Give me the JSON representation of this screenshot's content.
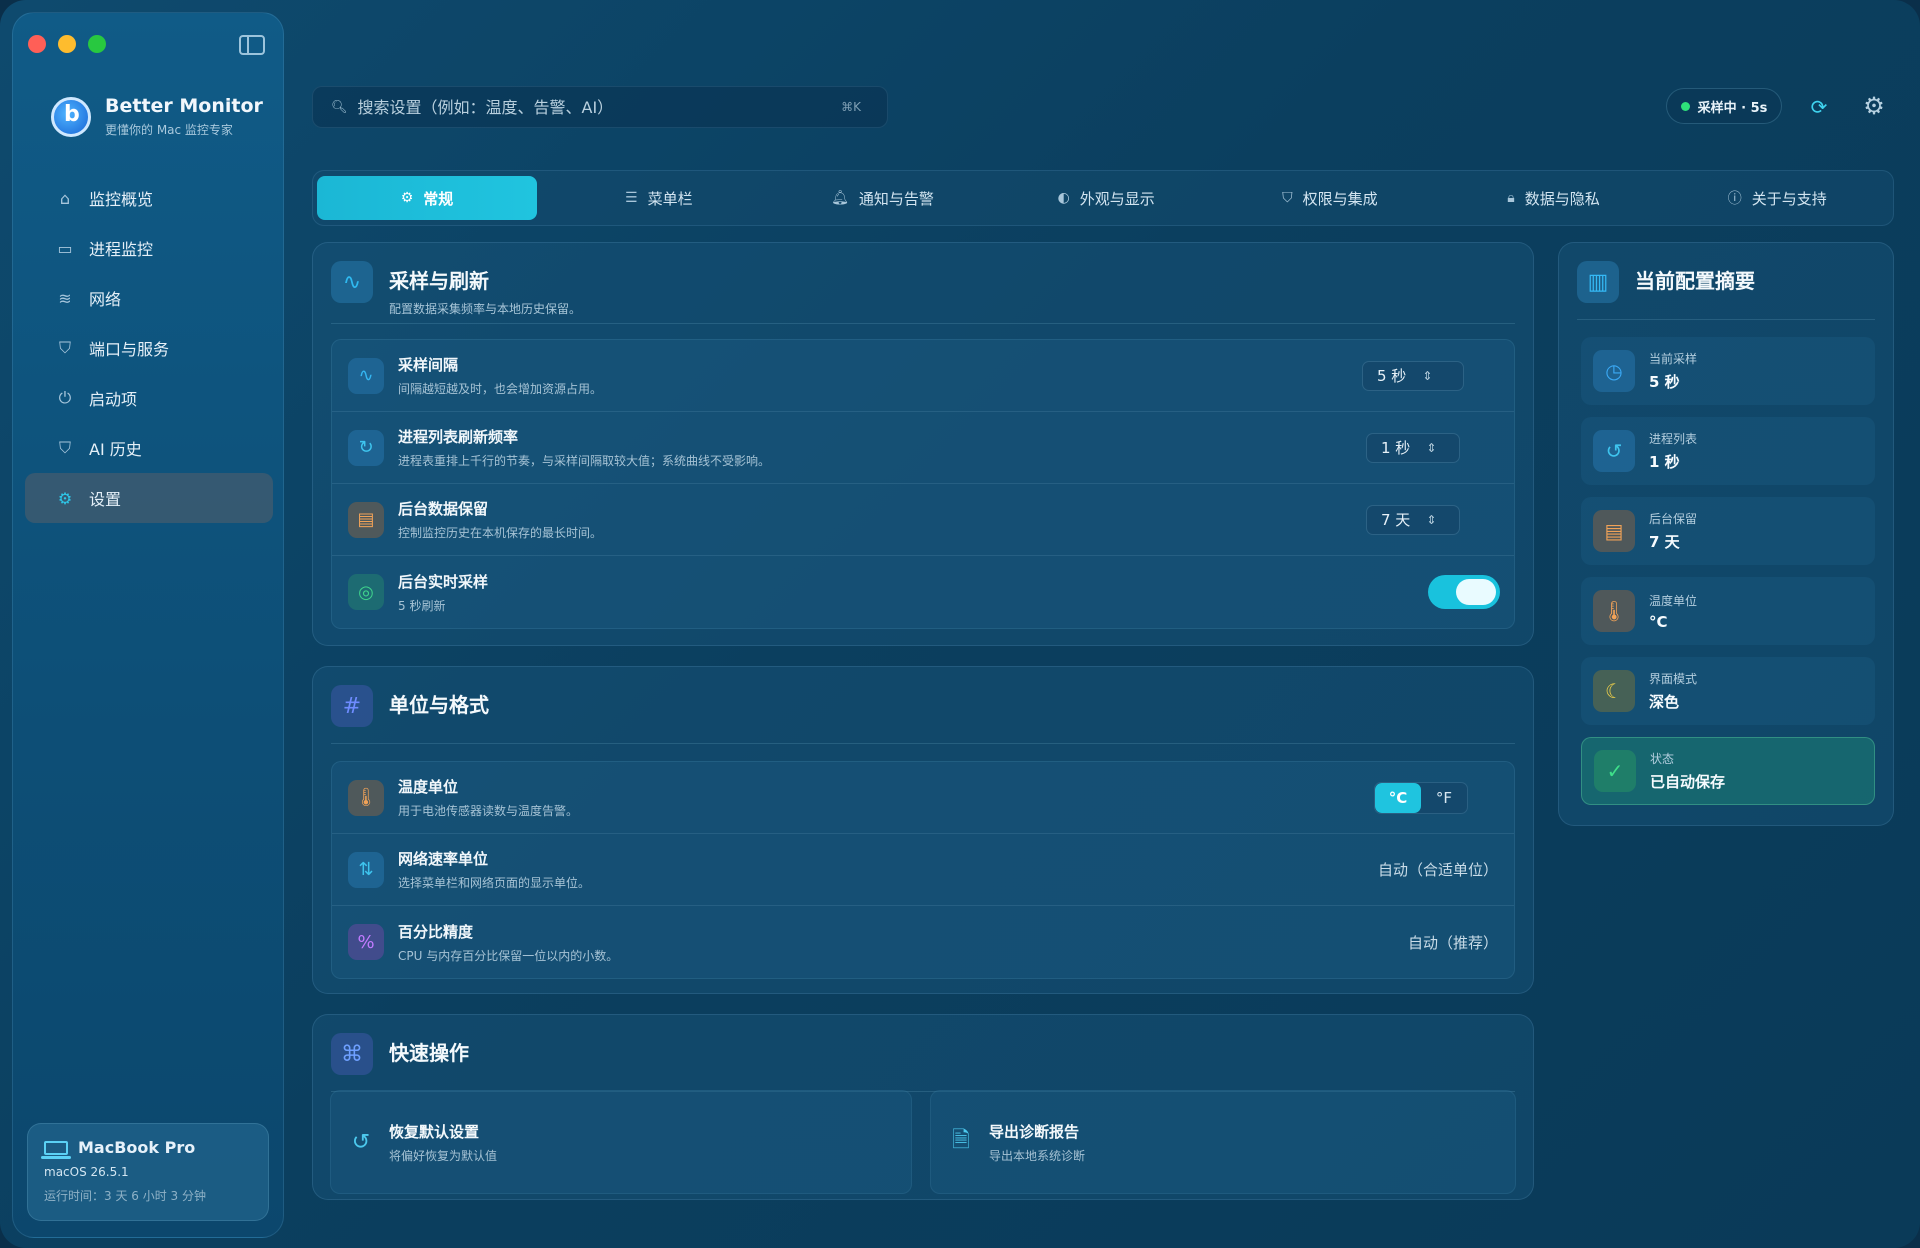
{
  "window": {
    "traffic_colors": [
      "#ff5f57",
      "#febc2e",
      "#28c840"
    ]
  },
  "app": {
    "name": "Better Monitor",
    "tagline": "更懂你的 Mac 监控专家"
  },
  "sidebar": {
    "items": [
      {
        "label": "监控概览",
        "icon": "home-icon"
      },
      {
        "label": "进程监控",
        "icon": "monitor-icon"
      },
      {
        "label": "网络",
        "icon": "wifi-icon"
      },
      {
        "label": "端口与服务",
        "icon": "shield-icon"
      },
      {
        "label": "启动项",
        "icon": "power-icon"
      },
      {
        "label": "AI 历史",
        "icon": "shield-check-icon"
      },
      {
        "label": "设置",
        "icon": "gear-icon",
        "active": true
      }
    ],
    "device": {
      "name": "MacBook Pro",
      "os": "macOS 26.5.1",
      "uptime": "运行时间：3 天 6 小时 3 分钟"
    }
  },
  "topbar": {
    "search_placeholder": "搜索设置（例如：温度、告警、AI）",
    "search_shortcut": "⌘K",
    "status": "采样中 · 5s"
  },
  "tabs": [
    {
      "label": "常规",
      "icon": "gear-icon",
      "active": true
    },
    {
      "label": "菜单栏",
      "icon": "list-icon"
    },
    {
      "label": "通知与告警",
      "icon": "bell-icon"
    },
    {
      "label": "外观与显示",
      "icon": "palette-icon"
    },
    {
      "label": "权限与集成",
      "icon": "shield-icon"
    },
    {
      "label": "数据与隐私",
      "icon": "lock-icon"
    },
    {
      "label": "关于与支持",
      "icon": "info-icon"
    }
  ],
  "sampling": {
    "title": "采样与刷新",
    "desc": "配置数据采集频率与本地历史保留。",
    "rows": [
      {
        "title": "采样间隔",
        "desc": "间隔越短越及时，也会增加资源占用。",
        "value": "5 秒"
      },
      {
        "title": "进程列表刷新频率",
        "desc": "进程表重排上千行的节奏，与采样间隔取较大值；系统曲线不受影响。",
        "value": "1 秒"
      },
      {
        "title": "后台数据保留",
        "desc": "控制监控历史在本机保存的最长时间。",
        "value": "7 天"
      },
      {
        "title": "后台实时采样",
        "desc": "5 秒刷新",
        "toggle_on": true
      }
    ]
  },
  "units": {
    "title": "单位与格式",
    "rows": [
      {
        "title": "温度单位",
        "desc": "用于电池传感器读数与温度告警。",
        "options": [
          "°C",
          "°F"
        ],
        "selected": "°C"
      },
      {
        "title": "网络速率单位",
        "desc": "选择菜单栏和网络页面的显示单位。",
        "value": "自动（合适单位）"
      },
      {
        "title": "百分比精度",
        "desc": "CPU 与内存百分比保留一位以内的小数。",
        "value": "自动（推荐）"
      }
    ]
  },
  "quick": {
    "title": "快速操作",
    "actions": [
      {
        "title": "恢复默认设置",
        "desc": "将偏好恢复为默认值"
      },
      {
        "title": "导出诊断报告",
        "desc": "导出本地系统诊断"
      }
    ]
  },
  "summary": {
    "title": "当前配置摘要",
    "items": [
      {
        "label": "当前采样",
        "value": "5 秒"
      },
      {
        "label": "进程列表",
        "value": "1 秒"
      },
      {
        "label": "后台保留",
        "value": "7 天"
      },
      {
        "label": "温度单位",
        "value": "°C"
      },
      {
        "label": "界面模式",
        "value": "深色"
      },
      {
        "label": "状态",
        "value": "已自动保存"
      }
    ]
  }
}
